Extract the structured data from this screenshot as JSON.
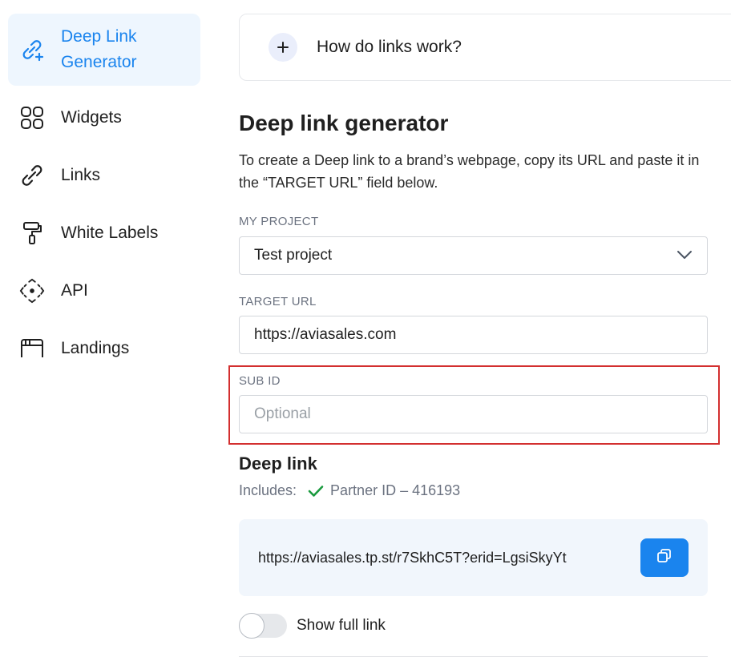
{
  "sidebar": {
    "items": [
      {
        "label": "Deep Link Generator",
        "icon": "link-plus-icon",
        "active": true
      },
      {
        "label": "Widgets",
        "icon": "widgets-grid-icon"
      },
      {
        "label": "Links",
        "icon": "link-icon"
      },
      {
        "label": "White Labels",
        "icon": "paint-roller-icon"
      },
      {
        "label": "API",
        "icon": "api-diamond-icon"
      },
      {
        "label": "Landings",
        "icon": "landing-window-icon"
      }
    ]
  },
  "faq": {
    "label": "How do links work?",
    "icon": "plus-icon"
  },
  "generator": {
    "title": "Deep link generator",
    "description": "To create a Deep link to a brand’s webpage, copy its URL and paste it in the “TARGET URL” field below.",
    "project_label": "MY PROJECT",
    "project_value": "Test project",
    "target_label": "TARGET URL",
    "target_value": "https://aviasales.com",
    "subid_label": "SUB ID",
    "subid_placeholder": "Optional"
  },
  "deep_link": {
    "title": "Deep link",
    "includes_label": "Includes:",
    "partner_id": "Partner ID – 416193",
    "url": "https://aviasales.tp.st/r7SkhC5T?erid=LgsiSkyYt",
    "toggle_label": "Show full link",
    "toggle_on": false
  },
  "colors": {
    "accent": "#1a84ee",
    "active_bg": "#eef6fe",
    "highlight": "#d32f2f",
    "check": "#1a9a3e"
  }
}
